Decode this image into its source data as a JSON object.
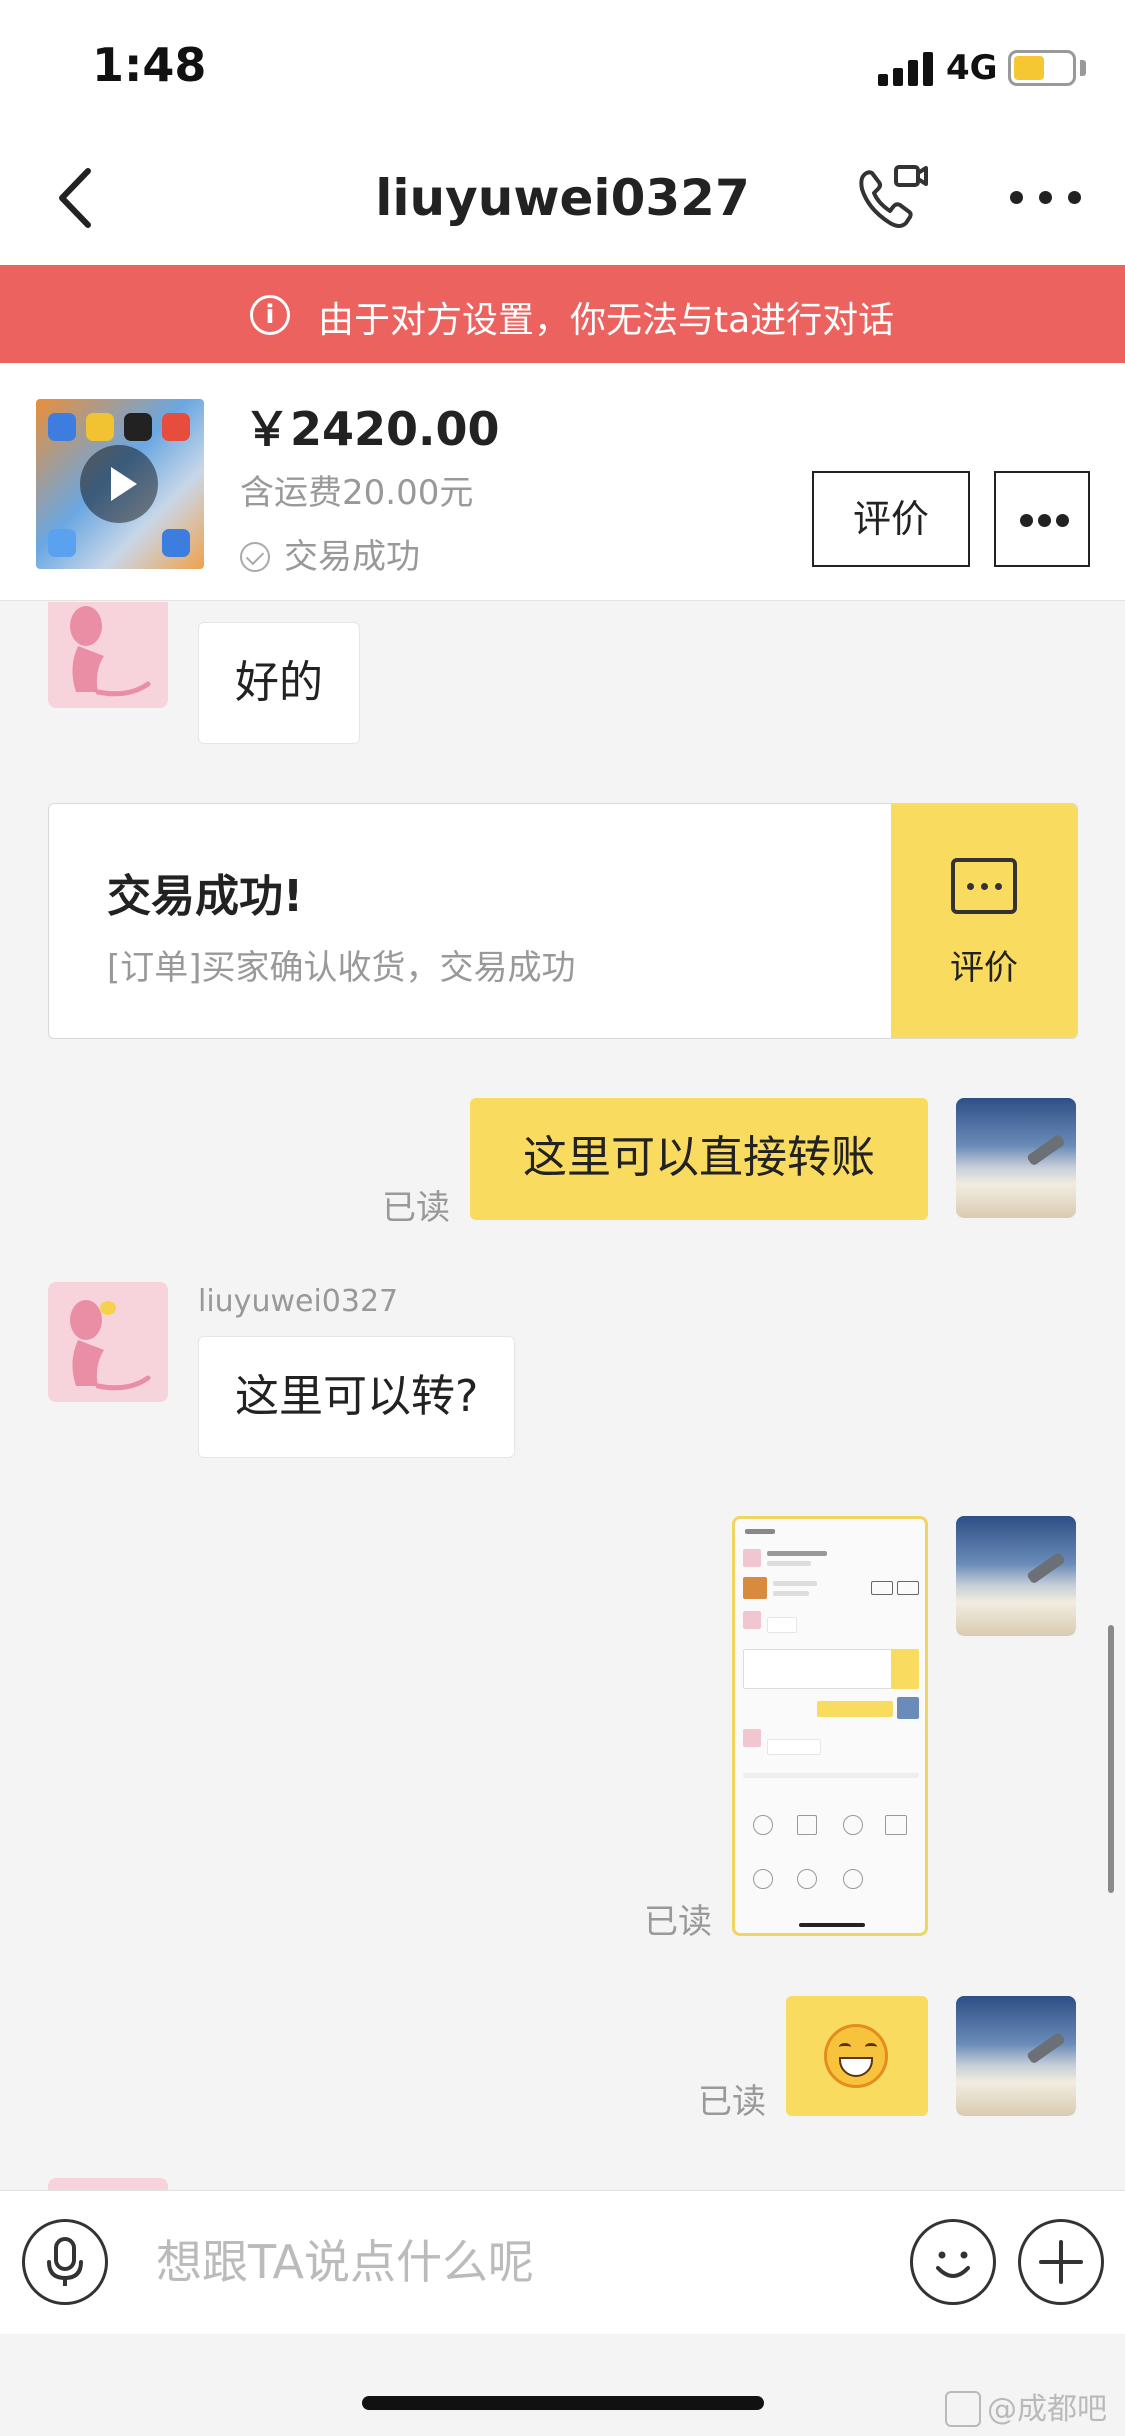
{
  "status_bar": {
    "time": "1:48",
    "network": "4G",
    "battery_color": "#f5c733"
  },
  "header": {
    "title": "liuyuwei0327",
    "icons": [
      "back-icon",
      "video-call-icon",
      "more-icon"
    ]
  },
  "banner": {
    "text": "由于对方设置，你无法与ta进行对话",
    "background": "#ec625e"
  },
  "product": {
    "price": "￥2420.00",
    "shipping": "含运费20.00元",
    "status": "交易成功",
    "rate_label": "评价"
  },
  "messages": {
    "m1_text": "好的",
    "order_title": "交易成功!",
    "order_desc": "[订单]买家确认收货，交易成功",
    "order_action": "评价",
    "m2_text": "这里可以直接转账",
    "read_label": "已读",
    "m3_sender": "liuyuwei0327",
    "m3_text": "这里可以转?"
  },
  "input_bar": {
    "placeholder": "想跟TA说点什么呢"
  },
  "watermark": "@成都吧",
  "colors": {
    "accent_yellow": "#f9db5f",
    "banner_red": "#ec625e"
  }
}
